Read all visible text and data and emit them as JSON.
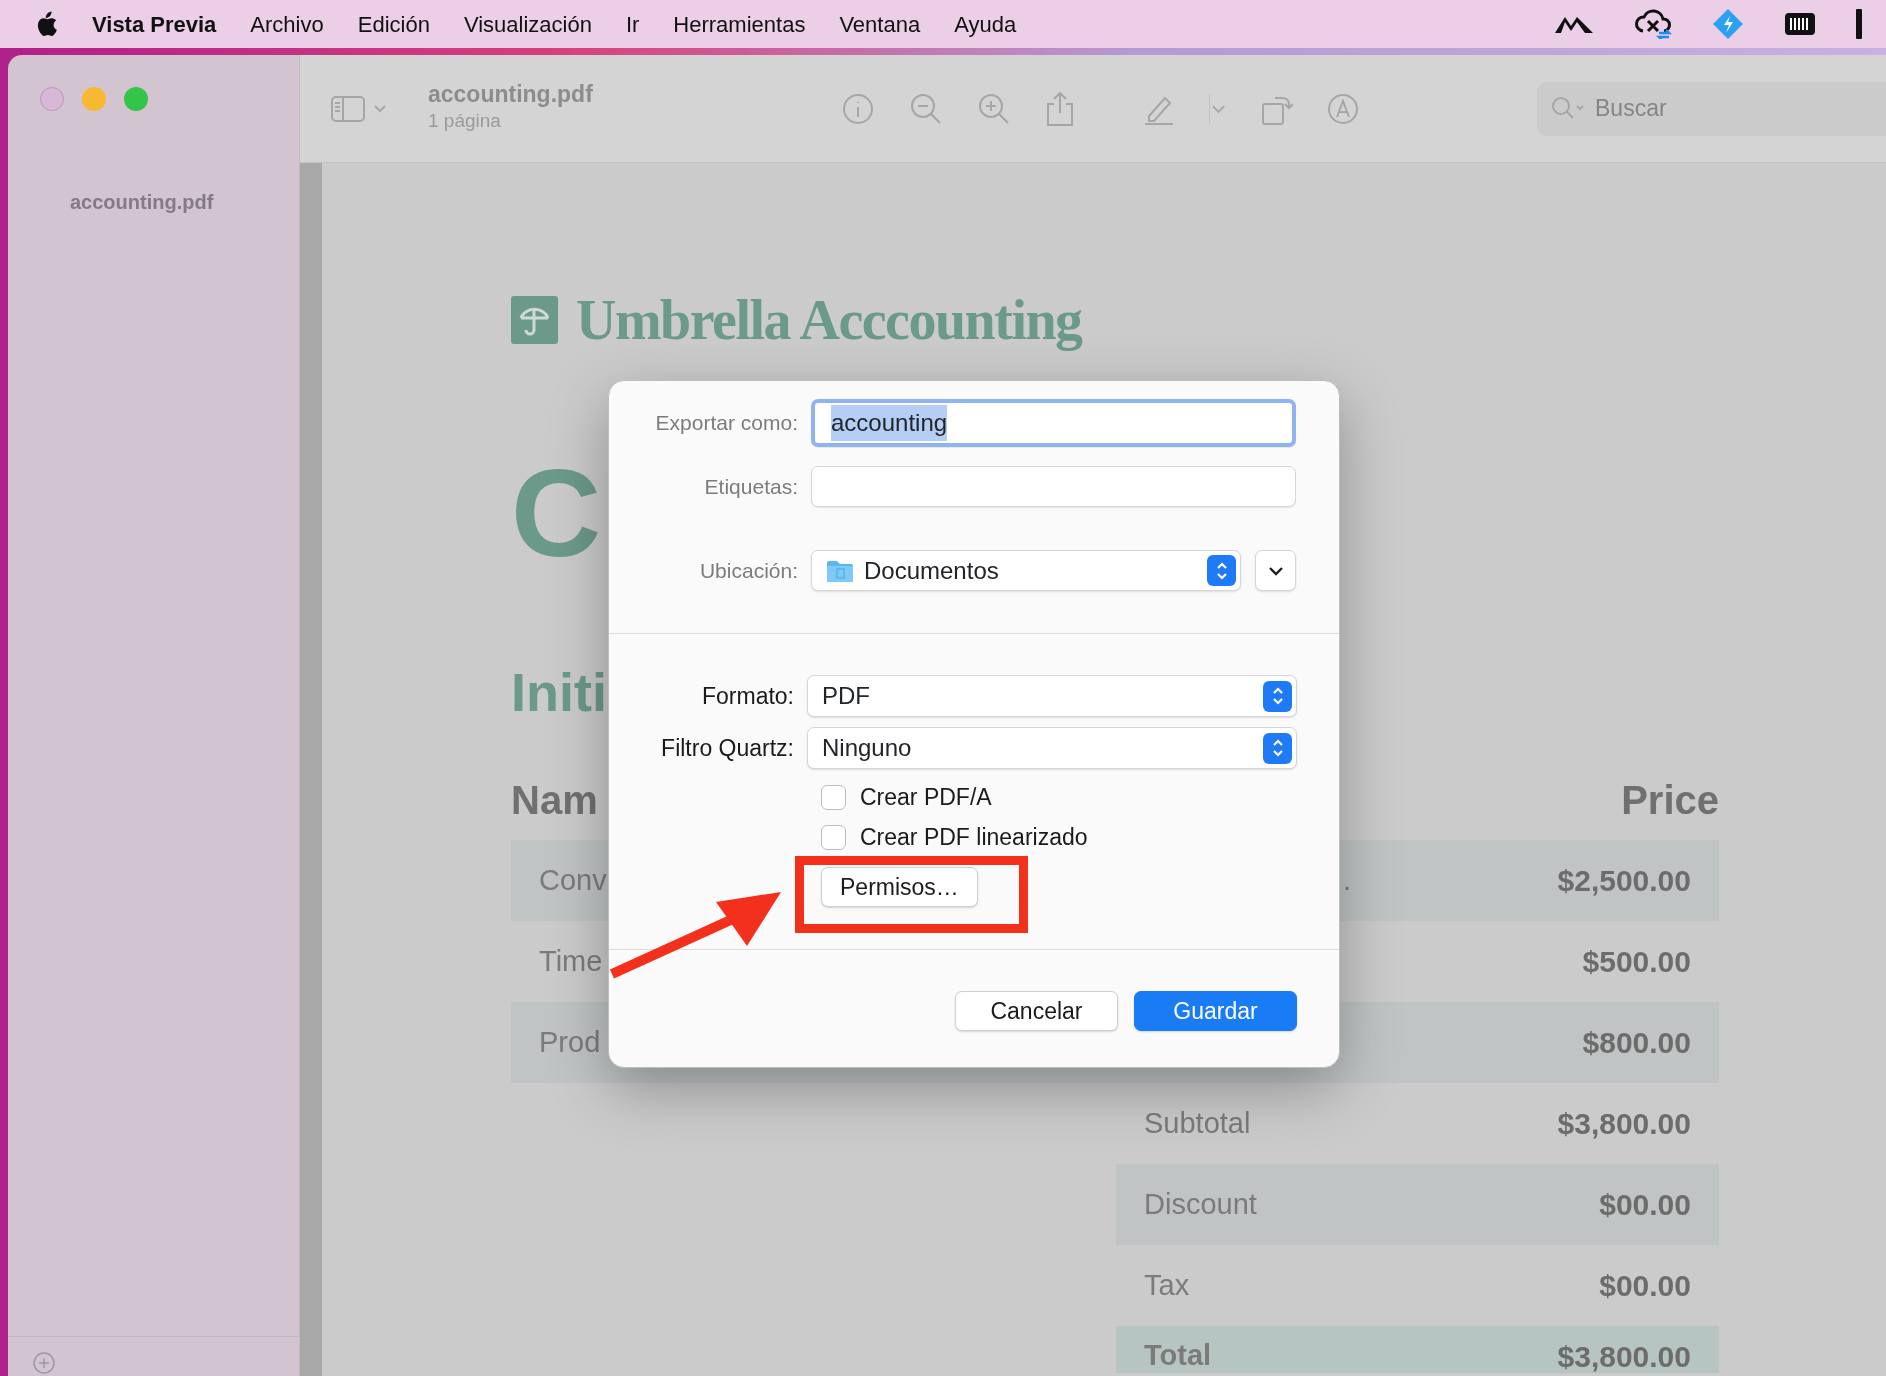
{
  "menu_bar": {
    "app_name": "Vista Previa",
    "items": [
      "Archivo",
      "Edición",
      "Visualización",
      "Ir",
      "Herramientas",
      "Ventana",
      "Ayuda"
    ]
  },
  "window": {
    "sidebar": {
      "items": [
        {
          "label": "accounting.pdf"
        }
      ]
    },
    "toolbar": {
      "title": "accounting.pdf",
      "subtitle": "1 página",
      "search": {
        "placeholder": "Buscar"
      }
    }
  },
  "document": {
    "brand": "Umbrella Acccounting",
    "heading": "C",
    "section_heading": "Initi",
    "table": {
      "columns": [
        "Nam",
        "Price"
      ],
      "rows": [
        {
          "column_1": "Conv",
          "column_2": ".",
          "price": "$2,500.00"
        },
        {
          "column_1": "Time",
          "price": "$500.00"
        },
        {
          "column_1": "Prod",
          "price": "$800.00"
        }
      ]
    },
    "totals": [
      {
        "label": "Subtotal",
        "value": "$3,800.00",
        "kind": "line"
      },
      {
        "label": "Discount",
        "value": "$00.00",
        "kind": "line"
      },
      {
        "label": "Tax",
        "value": "$00.00",
        "kind": "line"
      },
      {
        "label": "Total",
        "value": "$3,800.00",
        "kind": "total"
      }
    ]
  },
  "dialog": {
    "fields": [
      {
        "label": "Exportar como:",
        "value": "accounting",
        "focused": true
      },
      {
        "label": "Etiquetas:",
        "focused": false
      }
    ],
    "location": {
      "label": "Ubicación:",
      "value": "Documentos"
    },
    "popups": [
      {
        "label": "Formato:",
        "value": "PDF"
      },
      {
        "label": "Filtro Quartz:",
        "value": "Ninguno"
      }
    ],
    "checkboxes": [
      {
        "label": "Crear PDF/A",
        "checked": false
      },
      {
        "label": "Crear PDF linearizado",
        "checked": false
      }
    ],
    "permissions_button": "Permisos…",
    "buttons": [
      {
        "label": "Cancelar",
        "primary": false
      },
      {
        "label": "Guardar",
        "primary": true
      }
    ]
  }
}
